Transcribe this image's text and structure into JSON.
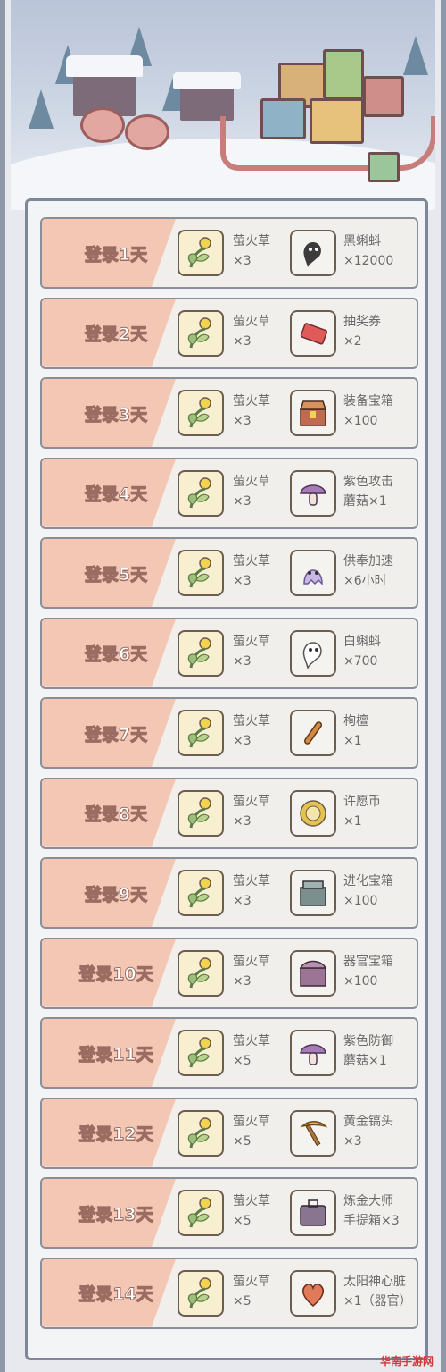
{
  "rewards": [
    {
      "day": "登录1天",
      "item1": {
        "name": "萤火草",
        "qty": "×3",
        "icon": "firefly-grass-icon"
      },
      "item2": {
        "name": "黑蝌蚪",
        "qty": "×12000",
        "icon": "black-tadpole-icon"
      }
    },
    {
      "day": "登录2天",
      "item1": {
        "name": "萤火草",
        "qty": "×3",
        "icon": "firefly-grass-icon"
      },
      "item2": {
        "name": "抽奖券",
        "qty": "×2",
        "icon": "lottery-ticket-icon"
      }
    },
    {
      "day": "登录3天",
      "item1": {
        "name": "萤火草",
        "qty": "×3",
        "icon": "firefly-grass-icon"
      },
      "item2": {
        "name": "装备宝箱",
        "qty": "×100",
        "icon": "equipment-chest-icon"
      }
    },
    {
      "day": "登录4天",
      "item1": {
        "name": "萤火草",
        "qty": "×3",
        "icon": "firefly-grass-icon"
      },
      "item2": {
        "name": "紫色攻击",
        "qty": "蘑菇×1",
        "icon": "purple-attack-mushroom-icon"
      }
    },
    {
      "day": "登录5天",
      "item1": {
        "name": "萤火草",
        "qty": "×3",
        "icon": "firefly-grass-icon"
      },
      "item2": {
        "name": "供奉加速",
        "qty": "×6小时",
        "icon": "offering-speedup-icon"
      }
    },
    {
      "day": "登录6天",
      "item1": {
        "name": "萤火草",
        "qty": "×3",
        "icon": "firefly-grass-icon"
      },
      "item2": {
        "name": "白蝌蚪",
        "qty": "×700",
        "icon": "white-tadpole-icon"
      }
    },
    {
      "day": "登录7天",
      "item1": {
        "name": "萤火草",
        "qty": "×3",
        "icon": "firefly-grass-icon"
      },
      "item2": {
        "name": "栒檀",
        "qty": "×1",
        "icon": "sandalwood-icon"
      }
    },
    {
      "day": "登录8天",
      "item1": {
        "name": "萤火草",
        "qty": "×3",
        "icon": "firefly-grass-icon"
      },
      "item2": {
        "name": "许愿币",
        "qty": "×1",
        "icon": "wish-coin-icon"
      }
    },
    {
      "day": "登录9天",
      "item1": {
        "name": "萤火草",
        "qty": "×3",
        "icon": "firefly-grass-icon"
      },
      "item2": {
        "name": "进化宝箱",
        "qty": "×100",
        "icon": "evolution-chest-icon"
      }
    },
    {
      "day": "登录10天",
      "item1": {
        "name": "萤火草",
        "qty": "×3",
        "icon": "firefly-grass-icon"
      },
      "item2": {
        "name": "器官宝箱",
        "qty": "×100",
        "icon": "organ-chest-icon"
      }
    },
    {
      "day": "登录11天",
      "item1": {
        "name": "萤火草",
        "qty": "×5",
        "icon": "firefly-grass-icon"
      },
      "item2": {
        "name": "紫色防御",
        "qty": "蘑菇×1",
        "icon": "purple-defense-mushroom-icon"
      }
    },
    {
      "day": "登录12天",
      "item1": {
        "name": "萤火草",
        "qty": "×5",
        "icon": "firefly-grass-icon"
      },
      "item2": {
        "name": "黄金镐头",
        "qty": "×3",
        "icon": "golden-pickaxe-icon"
      }
    },
    {
      "day": "登录13天",
      "item1": {
        "name": "萤火草",
        "qty": "×5",
        "icon": "firefly-grass-icon"
      },
      "item2": {
        "name": "炼金大师",
        "qty": "手提箱×3",
        "icon": "alchemy-suitcase-icon"
      }
    },
    {
      "day": "登录14天",
      "item1": {
        "name": "萤火草",
        "qty": "×5",
        "icon": "firefly-grass-icon"
      },
      "item2": {
        "name": "太阳神心脏",
        "qty": "×1（器官）",
        "icon": "sun-god-heart-icon"
      }
    }
  ],
  "watermark": "华南手游网"
}
